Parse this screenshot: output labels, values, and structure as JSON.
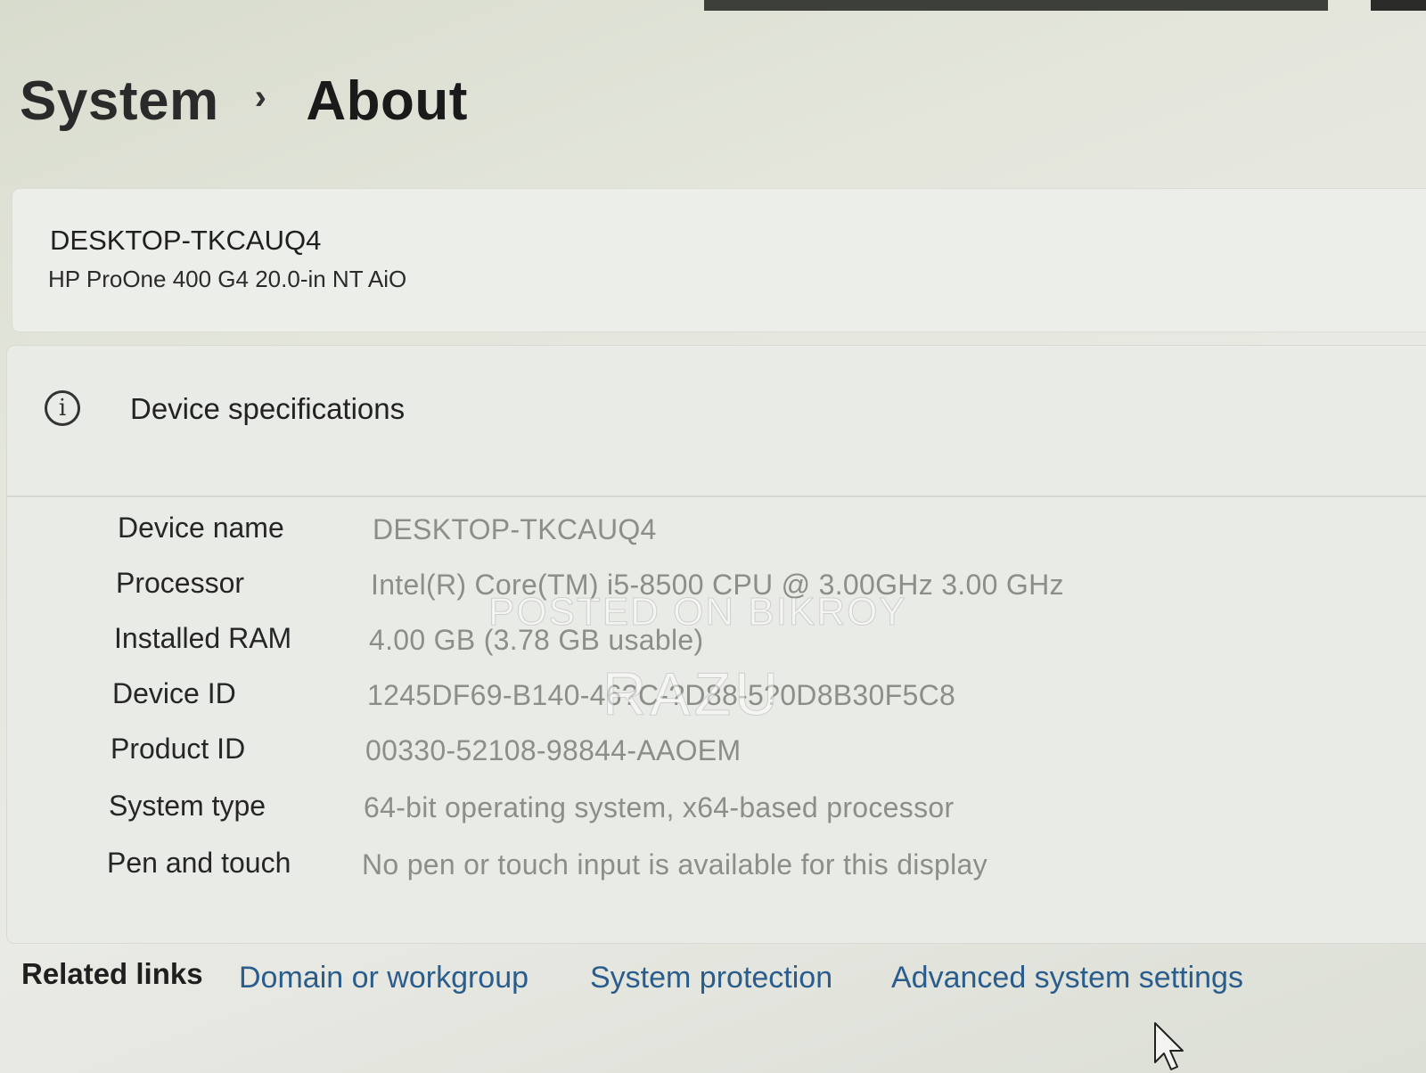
{
  "breadcrumb": {
    "parent": "System",
    "separator": "›",
    "current": "About"
  },
  "device": {
    "name": "DESKTOP-TKCAUQ4",
    "model": "HP ProOne 400 G4 20.0-in NT AiO"
  },
  "specs": {
    "title": "Device specifications",
    "icon": "info-icon",
    "rows": [
      {
        "label": "Device name",
        "value": "DESKTOP-TKCAUQ4"
      },
      {
        "label": "Processor",
        "value": "Intel(R) Core(TM) i5-8500 CPU @ 3.00GHz   3.00 GHz"
      },
      {
        "label": "Installed RAM",
        "value": "4.00 GB (3.78 GB usable)"
      },
      {
        "label": "Device ID",
        "value": "1245DF69-B140-46?C-?D88-5?0D8B30F5C8"
      },
      {
        "label": "Product ID",
        "value": "00330-52108-98844-AAOEM"
      },
      {
        "label": "System type",
        "value": "64-bit operating system, x64-based processor"
      },
      {
        "label": "Pen and touch",
        "value": "No pen or touch input is available for this display"
      }
    ]
  },
  "watermark": {
    "line1": "POSTED ON BIKROY",
    "line2": "RAZU"
  },
  "related": {
    "label": "Related links",
    "links": [
      {
        "label": "Domain or workgroup"
      },
      {
        "label": "System protection"
      },
      {
        "label": "Advanced system settings"
      }
    ]
  },
  "colors": {
    "link": "#2a5d8c",
    "value_text": "#8c8f88",
    "card_bg": "#e9ebe6"
  }
}
